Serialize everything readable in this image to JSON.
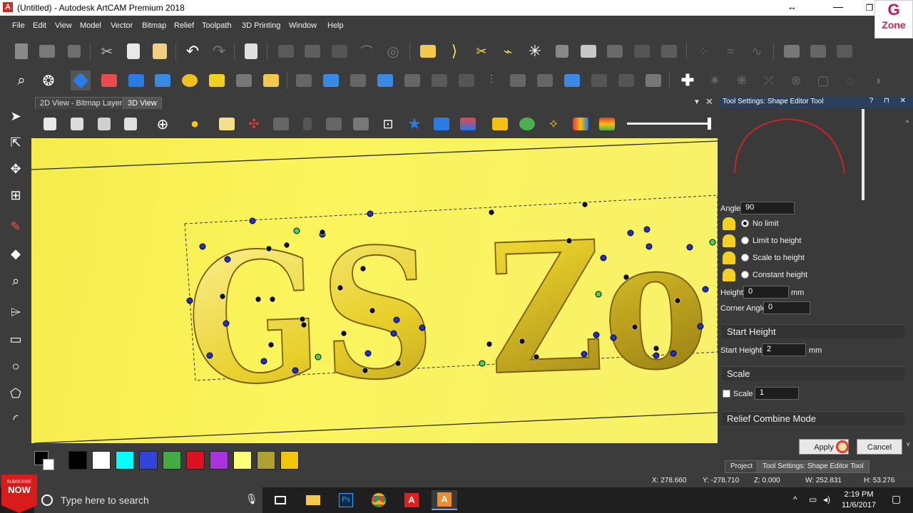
{
  "window": {
    "title": "(Untitled) - Autodesk ArtCAM Premium 2018",
    "app_icon_letter": "A",
    "minimize": "—",
    "maximize": "❐"
  },
  "logo": {
    "g": "G",
    "text": "Zone"
  },
  "menu": [
    "File",
    "Edit",
    "View",
    "Model",
    "Vector",
    "Bitmap",
    "Relief",
    "Toolpath",
    "3D Printing",
    "Window",
    "Help"
  ],
  "tabs": {
    "bitmap_layer": "2D View - Bitmap Layer",
    "view3d": "3D View",
    "close": "✕",
    "arrow": "▼"
  },
  "viewport": {
    "text": "GS Zo"
  },
  "palette": [
    "#000000",
    "#ffffff",
    "#00ffff",
    "#3344dd",
    "#44aa44",
    "#dd1122",
    "#aa33dd",
    "#ffff77",
    "#b0a030",
    "#f2c40c"
  ],
  "panel": {
    "title": "Tool Settings: Shape Editor Tool",
    "header_buttons": "? ⊓ ✕",
    "angle_label": "Angle",
    "angle_value": "90",
    "options": [
      "No limit",
      "Limit to height",
      "Scale to height",
      "Constant height"
    ],
    "selected_option": 0,
    "height_label": "Height",
    "height_value": "0",
    "height_unit": "mm",
    "corner_angle_label": "Corner Angle",
    "corner_angle_value": "0",
    "start_height_section": "Start Height",
    "start_height_label": "Start Height",
    "start_height_value": "2",
    "start_height_unit": "mm",
    "scale_section": "Scale",
    "scale_label": "Scale",
    "scale_value": "1",
    "relief_section": "Relief Combine Mode",
    "apply": "Apply",
    "cancel": "Cancel"
  },
  "bottom_tabs": {
    "project": "Project",
    "tool_settings": "Tool Settings: Shape Editor Tool"
  },
  "status": {
    "x": "X: 278.660",
    "y": "Y: -278.710",
    "z": "Z: 0.000",
    "w": "W: 252.831",
    "h": "H: 53.276"
  },
  "taskbar": {
    "search_placeholder": "Type here to search",
    "time": "2:19 PM",
    "date": "11/6/2017",
    "subscribe_small": "SUBSCRIBE",
    "subscribe_big": "NOW"
  }
}
